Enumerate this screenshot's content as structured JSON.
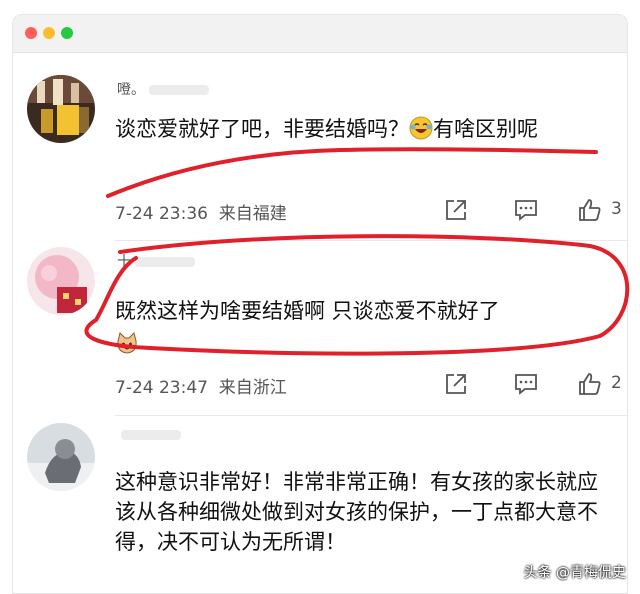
{
  "comments": [
    {
      "username": "噔。",
      "text": "谈恋爱就好了吧，非要结婚吗？",
      "text_after_emoji": "有啥区别呢",
      "time": "7-24 23:36",
      "location": "来自福建",
      "likes": "3"
    },
    {
      "username": "十",
      "text": "既然这样为啥要结婚啊 只谈恋爱不就好了",
      "time": "7-24 23:47",
      "location": "来自浙江",
      "likes": "2"
    },
    {
      "username": "",
      "text": "这种意识非常好！非常非常正确！有女孩的家长就应该从各种细微处做到对女孩的保护，一丁点都大意不得，决不可认为无所谓！"
    }
  ],
  "watermark": "头条 @青梅侃史",
  "colors": {
    "annotation_red": "#e0202a",
    "meta_gray": "#555555"
  }
}
